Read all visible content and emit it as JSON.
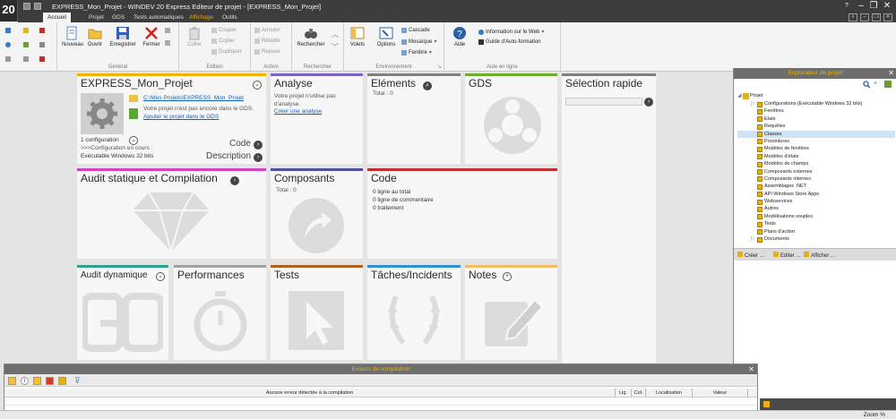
{
  "app": {
    "logo": "20",
    "title": "EXPRESS_Mon_Projet - WINDEV 20 Express  Editeur de projet - [EXPRESS_Mon_Projet]"
  },
  "menu": {
    "tabs": [
      "Accueil",
      "Projet",
      "GDS",
      "Tests automatiques",
      "Affichage",
      "Outils"
    ]
  },
  "ribbon": {
    "groups": {
      "general": "Général",
      "edition": "Edition",
      "action": "Action",
      "search": "Rechercher",
      "env": "Environnement",
      "help": "Aide en ligne"
    },
    "nouveau": "Nouveau",
    "ouvrir": "Ouvrir",
    "enregistrer": "Enregistrer",
    "fermer": "Fermer",
    "coller": "Coller",
    "couper": "Couper",
    "copier": "Copier",
    "dupliquer": "Dupliquer",
    "annuler": "Annuler",
    "retablir": "Rétablir",
    "rejouer": "Rejouer",
    "rechercher": "Rechercher",
    "volets": "Volets",
    "options": "Options",
    "cascade": "Cascade",
    "mosaique": "Mosaïque",
    "fenetre": "Fenêtre",
    "aide": "Aide",
    "info_web": "Information sur le Web",
    "guide": "Guide d'Auto-formation"
  },
  "tiles": {
    "projet": {
      "title": "EXPRESS_Mon_Projet",
      "path": "C:\\Mes Projets\\EXPRESS_Mon_Projet",
      "gds_note": "Votre projet n'est pas encore dans le GDS.",
      "gds_link": "Ajouter le projet dans le GDS",
      "config_count": "1 configuration",
      "config_current": ">>>Configuration en cours :",
      "config_name": "Exécutable Windows 32 bits",
      "code": "Code",
      "description": "Description"
    },
    "analyse": {
      "title": "Analyse",
      "note": "Votre projet n'utilise pas d'analyse.",
      "link": "Créer une analyse"
    },
    "elements": {
      "title": "Eléments",
      "total": "Total : 0"
    },
    "gds": {
      "title": "GDS"
    },
    "selection": {
      "title": "Sélection rapide"
    },
    "audit_statique": {
      "title": "Audit statique et Compilation"
    },
    "composants": {
      "title": "Composants",
      "total": "Total : 0"
    },
    "code": {
      "title": "Code",
      "lines": [
        "0 ligne au total",
        "0 ligne de commentaire",
        "0 traitement"
      ]
    },
    "audit_dynamique": {
      "title": "Audit dynamique"
    },
    "performances": {
      "title": "Performances"
    },
    "tests": {
      "title": "Tests"
    },
    "taches": {
      "title": "Tâches/Incidents"
    },
    "notes": {
      "title": "Notes"
    }
  },
  "explorer": {
    "title": "Explorateur de projet",
    "root": "Projet",
    "items": [
      "Configurations (Exécutable Windows 32 bits)",
      "Fenêtres",
      "Etats",
      "Requêtes",
      "Classes",
      "Procédures",
      "Modèles de fenêtres",
      "Modèles d'états",
      "Modèles de champs",
      "Composants externes",
      "Composants internes",
      "Assemblages .NET",
      "API Windows Store Apps",
      "Webservices",
      "Autres",
      "Modélisations souples",
      "Tests",
      "Plans d'action",
      "Documents"
    ],
    "selected": "Classes",
    "buttons": {
      "creer": "Créer ...",
      "editer": "Editer ...",
      "afficher": "Afficher ..."
    }
  },
  "errors": {
    "title": "Erreurs de compilation",
    "columns": {
      "message": "Aucune erreur détectée à la compilation",
      "lig": "Lig.",
      "col": "Col.",
      "localisation": "Localisation",
      "valeur": "Valeur"
    }
  },
  "status": {
    "zoom": "Zoom %"
  },
  "colors": {
    "projet": "#f0b400",
    "analyse": "#8060c0",
    "elements": "#808080",
    "gds": "#70b030",
    "selection": "#808080",
    "audit_statique": "#d040c0",
    "composants": "#5050a0",
    "code": "#c03030",
    "audit_dynamique": "#30a090",
    "performances": "#a0a0a0",
    "tests": "#b06020",
    "taches": "#3090d0",
    "notes": "#f0c060"
  }
}
